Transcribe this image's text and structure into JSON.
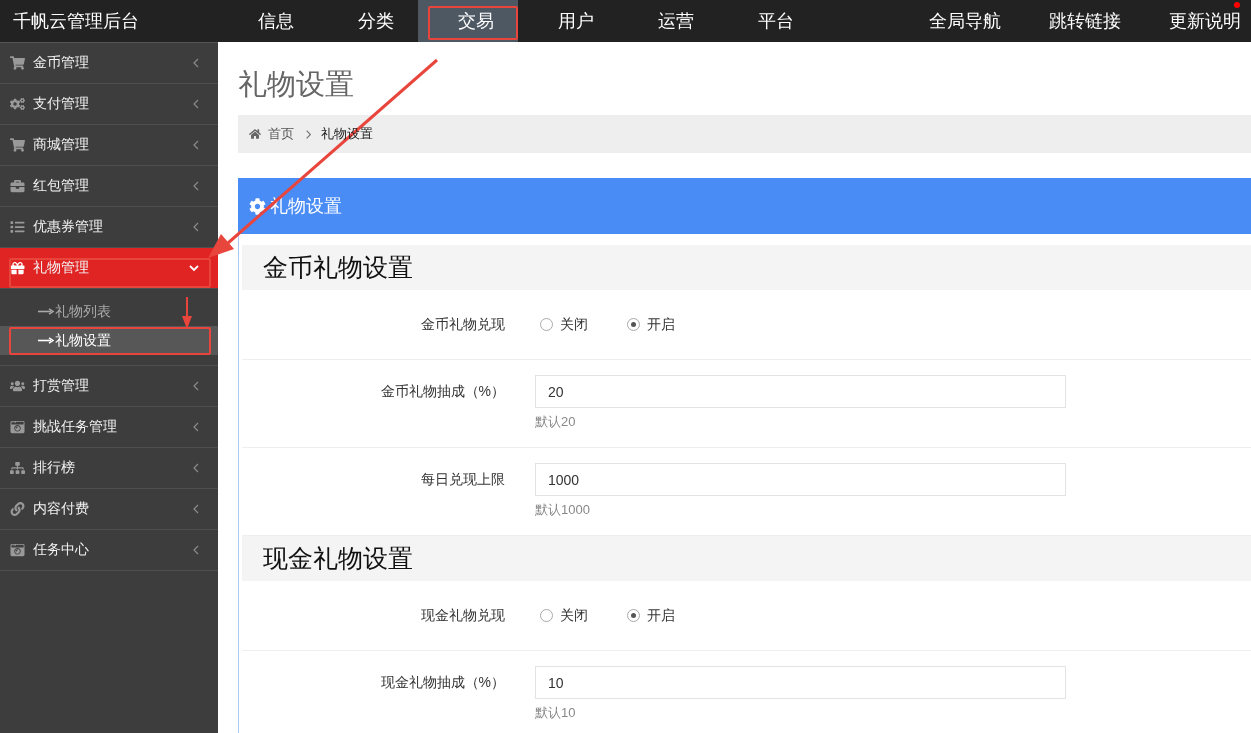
{
  "top_nav": {
    "brand": "千帆云管理后台",
    "tabs": [
      {
        "label": "信息",
        "selected": false,
        "marked": false
      },
      {
        "label": "分类",
        "selected": false,
        "marked": false
      },
      {
        "label": "交易",
        "selected": true,
        "marked": true
      },
      {
        "label": "用户",
        "selected": false,
        "marked": false
      },
      {
        "label": "运营",
        "selected": false,
        "marked": false
      },
      {
        "label": "平台",
        "selected": false,
        "marked": false
      }
    ],
    "links": [
      {
        "label": "全局导航",
        "dot": false
      },
      {
        "label": "跳转链接",
        "dot": false
      },
      {
        "label": "更新说明",
        "dot": true
      }
    ]
  },
  "sidebar": {
    "items": [
      {
        "label": "金币管理",
        "selected": false,
        "expanded": false,
        "marked": false
      },
      {
        "label": "支付管理",
        "selected": false,
        "expanded": false,
        "marked": false
      },
      {
        "label": "商城管理",
        "selected": false,
        "expanded": false,
        "marked": false
      },
      {
        "label": "红包管理",
        "selected": false,
        "expanded": false,
        "marked": false
      },
      {
        "label": "优惠券管理",
        "selected": false,
        "expanded": false,
        "marked": false
      },
      {
        "label": "礼物管理",
        "selected": true,
        "expanded": true,
        "marked": true,
        "children": [
          {
            "label": "礼物列表",
            "selected": false,
            "marked": false
          },
          {
            "label": "礼物设置",
            "selected": true,
            "marked": true
          }
        ]
      },
      {
        "label": "打赏管理",
        "selected": false,
        "expanded": false,
        "marked": false
      },
      {
        "label": "挑战任务管理",
        "selected": false,
        "expanded": false,
        "marked": false
      },
      {
        "label": "排行榜",
        "selected": false,
        "expanded": false,
        "marked": false
      },
      {
        "label": "内容付费",
        "selected": false,
        "expanded": false,
        "marked": false
      },
      {
        "label": "任务中心",
        "selected": false,
        "expanded": false,
        "marked": false
      }
    ]
  },
  "page_title": "礼物设置",
  "breadcrumb": [
    {
      "label": "首页"
    },
    {
      "label": "礼物设置"
    }
  ],
  "panel": {
    "title": "礼物设置",
    "sections": [
      {
        "title": "金币礼物设置",
        "fields": [
          {
            "kind": "radio",
            "label": "金币礼物兑现",
            "options": [
              {
                "label": "关闭",
                "selected": false
              },
              {
                "label": "开启",
                "selected": true
              }
            ]
          },
          {
            "kind": "input",
            "label": "金币礼物抽成（%）",
            "value": "20",
            "help": "默认20"
          },
          {
            "kind": "input",
            "label": "每日兑现上限",
            "value": "1000",
            "help": "默认1000"
          }
        ]
      },
      {
        "title": "现金礼物设置",
        "fields": [
          {
            "kind": "radio",
            "label": "现金礼物兑现",
            "options": [
              {
                "label": "关闭",
                "selected": false
              },
              {
                "label": "开启",
                "selected": true
              }
            ]
          },
          {
            "kind": "input",
            "label": "现金礼物抽成（%）",
            "value": "10",
            "help": "默认10"
          }
        ]
      }
    ]
  }
}
